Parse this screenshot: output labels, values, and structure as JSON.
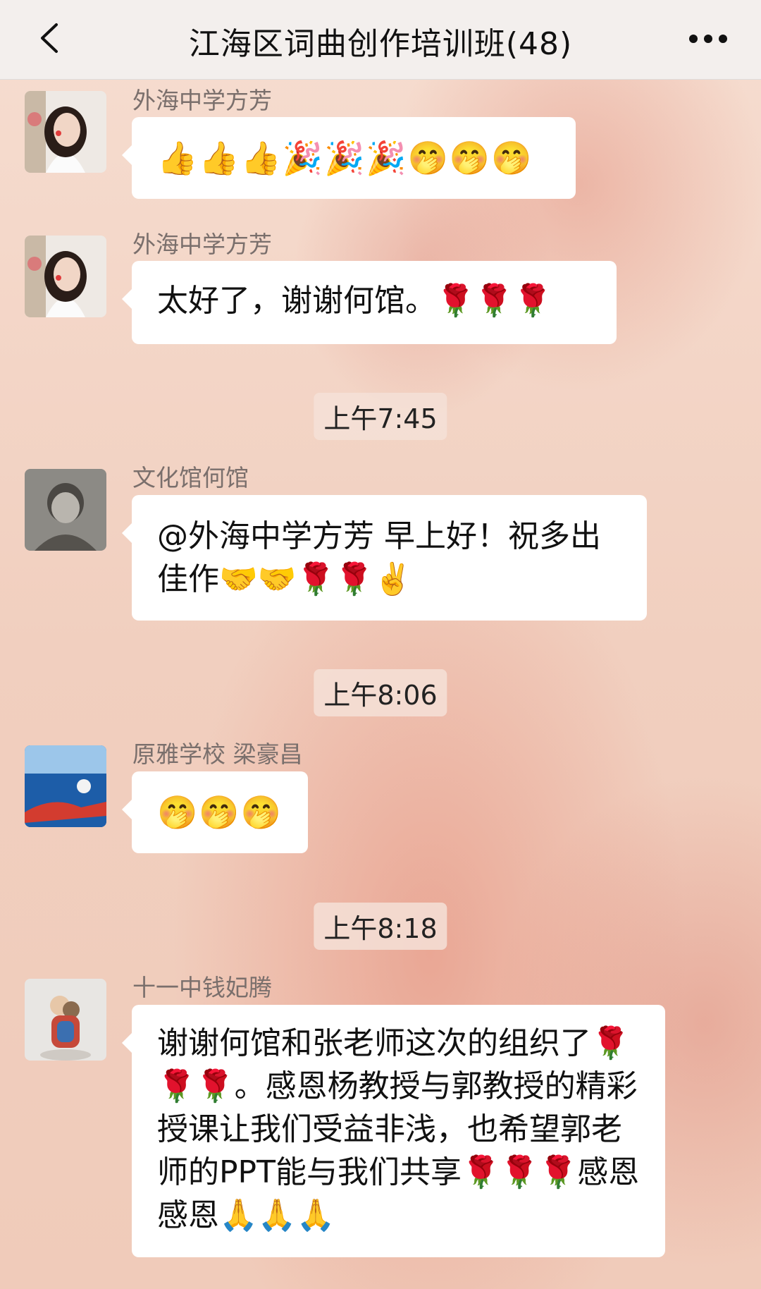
{
  "header": {
    "title": "江海区词曲创作培训班(48)",
    "back_icon": "chevron-left-icon",
    "more_icon": "more-dots-icon"
  },
  "messages": [
    {
      "sender": "外海中学方芳",
      "text": "👍👍👍🎉🎉🎉🤭🤭🤭"
    },
    {
      "sender": "外海中学方芳",
      "text": "太好了，谢谢何馆。🌹🌹🌹"
    },
    {
      "sender": "文化馆何馆",
      "text": "@外海中学方芳 早上好！祝多出佳作🤝🤝🌹🌹✌️"
    },
    {
      "sender": "原雅学校 梁豪昌",
      "text": "🤭🤭🤭"
    },
    {
      "sender": "十一中钱妃腾",
      "text": "谢谢何馆和张老师这次的组织了🌹🌹🌹。感恩杨教授与郭教授的精彩授课让我们受益非浅，也希望郭老师的PPT能与我们共享🌹🌹🌹感恩感恩🙏🙏🙏"
    }
  ],
  "timestamps": [
    "上午7:45",
    "上午8:06",
    "上午8:18"
  ],
  "colors": {
    "bubble": "#ffffff",
    "header_bg": "#f3efed",
    "accent": "#e07a64"
  }
}
